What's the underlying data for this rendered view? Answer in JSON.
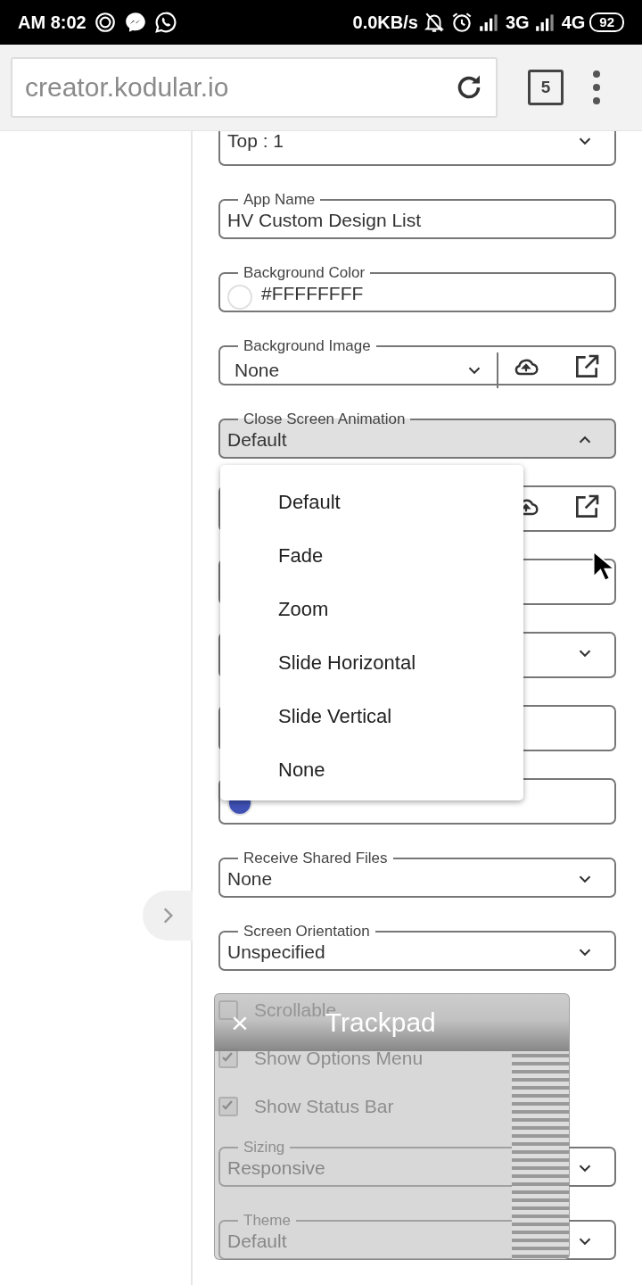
{
  "status_bar": {
    "time": "AM 8:02",
    "speed": "0.0KB/s",
    "network_1": "3G",
    "network_2": "4G",
    "battery": "92"
  },
  "browser": {
    "url": "creator.kodular.io",
    "tab_count": "5"
  },
  "fields": [
    {
      "kind": "select",
      "value": "Top : 1",
      "expanded": false
    },
    {
      "kind": "text",
      "label": "App Name",
      "value": "HV Custom Design List"
    },
    {
      "kind": "color",
      "label": "Background Color",
      "value": "#FFFFFFFF",
      "color": "#ffffff"
    },
    {
      "kind": "asset",
      "label": "Background Image",
      "value": "None"
    },
    {
      "kind": "select",
      "label": "Close Screen Animation",
      "value": "Default",
      "expanded": true
    },
    {
      "kind": "asset"
    },
    {
      "kind": "text"
    },
    {
      "kind": "select",
      "expanded": false
    },
    {
      "kind": "text"
    },
    {
      "kind": "color",
      "color": "#3f51b5"
    },
    {
      "kind": "select",
      "label": "Receive Shared Files",
      "value": "None",
      "expanded": false
    },
    {
      "kind": "select",
      "label": "Screen Orientation",
      "value": "Unspecified",
      "expanded": false
    }
  ],
  "checkboxes": [
    {
      "label": "Scrollable",
      "checked": false
    },
    {
      "label": "Show Options Menu",
      "checked": true
    },
    {
      "label": "Show Status Bar",
      "checked": true
    }
  ],
  "fields_after": [
    {
      "kind": "select",
      "label": "Sizing",
      "value": "Responsive",
      "expanded": false
    },
    {
      "kind": "select",
      "label": "Theme",
      "value": "Default",
      "expanded": false
    }
  ],
  "menu": {
    "items": [
      "Default",
      "Fade",
      "Zoom",
      "Slide Horizontal",
      "Slide Vertical",
      "None"
    ]
  },
  "trackpad": {
    "title": "Trackpad",
    "close": "×"
  }
}
